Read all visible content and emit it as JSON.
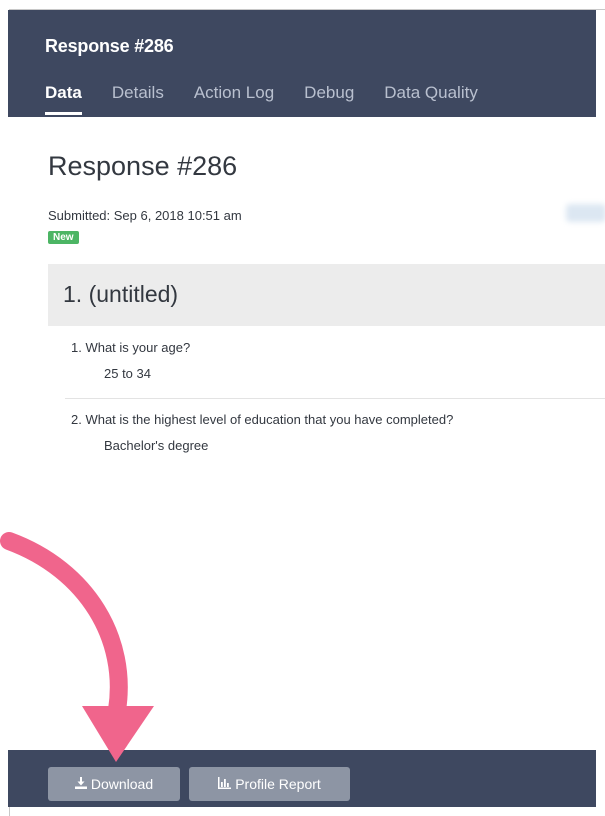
{
  "header": {
    "title": "Response #286",
    "tabs": [
      {
        "label": "Data",
        "active": true
      },
      {
        "label": "Details",
        "active": false
      },
      {
        "label": "Action Log",
        "active": false
      },
      {
        "label": "Debug",
        "active": false
      },
      {
        "label": "Data Quality",
        "active": false
      }
    ]
  },
  "content": {
    "title": "Response #286",
    "submitted": "Submitted: Sep 6, 2018 10:51 am",
    "status_badge": "New",
    "section_title": "1. (untitled)",
    "questions": [
      {
        "question": "1. What is your age?",
        "answer": "25 to 34"
      },
      {
        "question": "2. What is the highest level of education that you have completed?",
        "answer": "Bachelor's degree"
      }
    ]
  },
  "footer": {
    "download_label": "Download",
    "profile_label": "Profile Report",
    "download_icon": "download-icon",
    "profile_icon": "bar-chart-icon"
  },
  "colors": {
    "header_bg": "#3e4860",
    "badge_green": "#4cb564",
    "arrow_pink": "#f0658c",
    "button_gray": "#8d95a4"
  }
}
